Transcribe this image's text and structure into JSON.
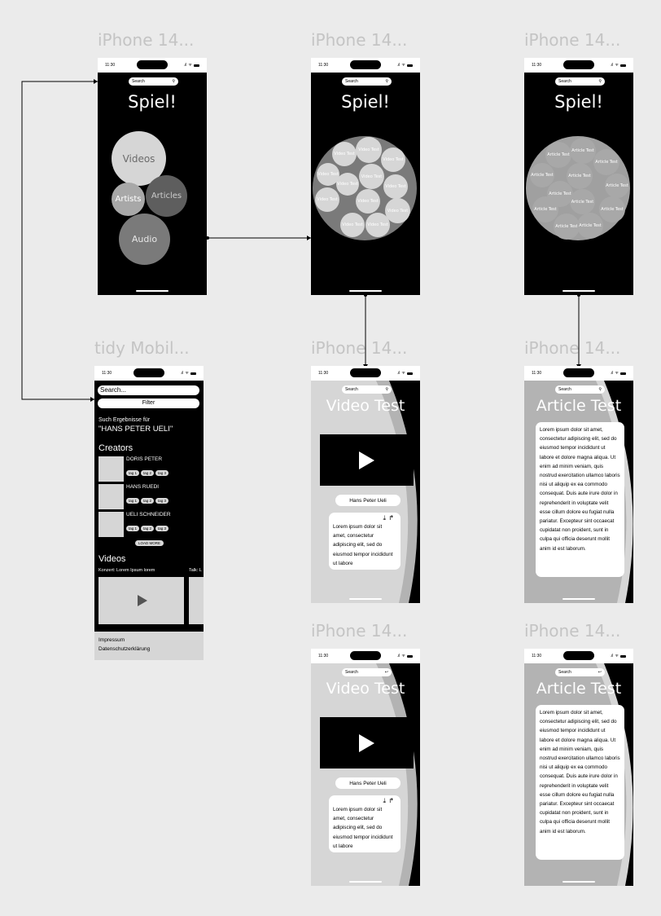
{
  "frame_labels": [
    "iPhone 14...",
    "iPhone 14...",
    "iPhone 14...",
    "tidy Mobil...",
    "iPhone 14...",
    "iPhone 14...",
    "iPhone 14...",
    "iPhone 14..."
  ],
  "status_time": "11:30",
  "search_placeholder": "Search",
  "app_title": "Spiel!",
  "home": {
    "bubbles": {
      "videos": "Videos",
      "artists": "Artists",
      "articles": "Articles",
      "audio": "Audio"
    }
  },
  "video_cluster": {
    "bubble_labels": [
      "Video Test",
      "Video Test",
      "Video Test",
      "Video Test",
      "Video Test",
      "Video Test",
      "Video Test",
      "Video Test",
      "Video Test",
      "Video Test",
      "Video Test",
      "Video Test",
      "Video Test"
    ]
  },
  "article_cluster": {
    "bubble_labels": [
      "Article Test",
      "Article Test",
      "Article Test",
      "Article Test",
      "Article Test",
      "Article Test",
      "Article Test",
      "Article Test",
      "Article Test",
      "Article Test",
      "Article Test",
      "Article Test",
      "Article Test"
    ]
  },
  "search_results": {
    "search_value": "Search...",
    "filter_label": "Filter",
    "results_for": "Such Ergebnisse für",
    "query": "\"HANS PETER UELI\"",
    "creators_heading": "Creators",
    "creators": [
      {
        "name": "DORIS PETER",
        "tags": [
          "tag 1",
          "tag 2",
          "tag 3"
        ]
      },
      {
        "name": "HANS RUEDI",
        "tags": [
          "tag 1",
          "tag 2",
          "tag 3"
        ]
      },
      {
        "name": "UELI SCHNEIDER",
        "tags": [
          "tag 1",
          "tag 2",
          "tag 3"
        ]
      }
    ],
    "load_more": "LOAD MORE",
    "videos_heading": "Videos",
    "video_captions": [
      "Konzert: Lorem Ipsum lorem",
      "Talk: L"
    ],
    "footer_links": [
      "Impressum",
      "Datenschutzerklärung"
    ]
  },
  "video_detail": {
    "title": "Video Test",
    "creator": "Hans Peter Ueli",
    "body": "Lorem ipsum dolor sit amet, consectetur adipiscing elit, sed do eiusmod tempor incididunt ut labore"
  },
  "article_detail": {
    "title": "Article Test",
    "body": "Lorem ipsum dolor sit amet, consectetur adipiscing elit, sed do eiusmod tempor incididunt ut labore et dolore magna aliqua. Ut enim ad minim veniam, quis nostrud exercitation ullamco laboris nisi ut aliquip ex ea commodo consequat. Duis aute irure dolor in reprehenderit in voluptate velit esse cillum dolore eu fugiat nulla pariatur. Excepteur sint occaecat cupidatat non proident, sunt in culpa qui officia deserunt mollit anim id est laborum."
  },
  "icons": {
    "search": "search-icon",
    "download": "download-icon",
    "share": "share-icon",
    "back": "back-arrow-icon",
    "play": "play-icon"
  },
  "colors": {
    "canvas": "#ebebeb",
    "screen_dark": "#000000",
    "screen_gray": "#b3b3b3",
    "bubble_light": "#d6d6d6",
    "bubble_mid": "#a8a8a8",
    "bubble_dark": "#5e5e5e"
  }
}
